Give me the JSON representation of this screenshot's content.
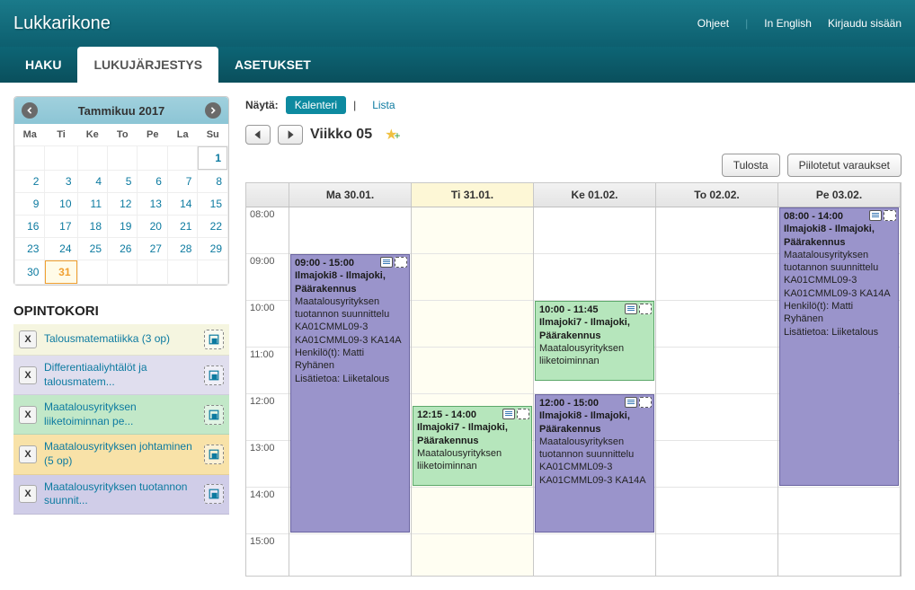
{
  "header": {
    "brand": "Lukkarikone",
    "links": {
      "help": "Ohjeet",
      "lang": "In English",
      "login": "Kirjaudu sisään"
    }
  },
  "nav": {
    "tabs": [
      "HAKU",
      "LUKUJÄRJESTYS",
      "ASETUKSET"
    ],
    "active": 1
  },
  "calendar": {
    "title": "Tammikuu 2017",
    "dow": [
      "Ma",
      "Ti",
      "Ke",
      "To",
      "Pe",
      "La",
      "Su"
    ],
    "weeks": [
      [
        "",
        "",
        "",
        "",
        "",
        "",
        "1"
      ],
      [
        "2",
        "3",
        "4",
        "5",
        "6",
        "7",
        "8"
      ],
      [
        "9",
        "10",
        "11",
        "12",
        "13",
        "14",
        "15"
      ],
      [
        "16",
        "17",
        "18",
        "19",
        "20",
        "21",
        "22"
      ],
      [
        "23",
        "24",
        "25",
        "26",
        "27",
        "28",
        "29"
      ],
      [
        "30",
        "31",
        "",
        "",
        "",
        "",
        ""
      ]
    ],
    "today": "31"
  },
  "basket": {
    "title": "OPINTOKORI",
    "items": [
      {
        "label": "Talousmatematiikka (3 op)",
        "color": "c0"
      },
      {
        "label": "Differentiaaliyhtälöt ja talousmatem...",
        "color": "c1"
      },
      {
        "label": "Maatalousyrityksen liiketoiminnan pe...",
        "color": "c2"
      },
      {
        "label": "Maatalousyrityksen johtaminen (5 op)",
        "color": "c3"
      },
      {
        "label": "Maatalousyrityksen tuotannon suunnit...",
        "color": "c4"
      }
    ]
  },
  "view": {
    "label": "Näytä:",
    "calendar": "Kalenteri",
    "list": "Lista"
  },
  "week": {
    "title": "Viikko 05"
  },
  "buttons": {
    "print": "Tulosta",
    "hidden": "Piilotetut varaukset"
  },
  "schedule": {
    "days": [
      "Ma 30.01.",
      "Ti 31.01.",
      "Ke 01.02.",
      "To 02.02.",
      "Pe 03.02."
    ],
    "todayIndex": 1,
    "hours": [
      "08:00",
      "09:00",
      "10:00",
      "11:00",
      "12:00",
      "13:00",
      "14:00",
      "15:00"
    ],
    "events": [
      {
        "day": 0,
        "start": "09:00",
        "end": "15:00",
        "color": "purple",
        "time": "09:00 - 15:00",
        "loc": "Ilmajoki8 - Ilmajoki, Päärakennus",
        "lines": [
          "Maatalousyrityksen tuotannon suunnittelu KA01CMML09-3",
          "",
          "KA01CMML09-3 KA14A",
          "Henkilö(t): Matti Ryhänen",
          "Lisätietoa: Liiketalous"
        ]
      },
      {
        "day": 1,
        "start": "12:15",
        "end": "14:00",
        "color": "green",
        "time": "12:15 - 14:00",
        "loc": "Ilmajoki7 - Ilmajoki, Päärakennus",
        "lines": [
          "Maatalousyrityksen liiketoiminnan"
        ]
      },
      {
        "day": 2,
        "start": "10:00",
        "end": "11:45",
        "color": "green",
        "time": "10:00 - 11:45",
        "loc": "Ilmajoki7 - Ilmajoki, Päärakennus",
        "lines": [
          "Maatalousyrityksen liiketoiminnan"
        ]
      },
      {
        "day": 2,
        "start": "12:00",
        "end": "15:00",
        "color": "purple",
        "time": "12:00 - 15:00",
        "loc": "Ilmajoki8 - Ilmajoki, Päärakennus",
        "lines": [
          "Maatalousyrityksen tuotannon suunnittelu KA01CMML09-3",
          "",
          "KA01CMML09-3 KA14A"
        ]
      },
      {
        "day": 4,
        "start": "08:00",
        "end": "14:00",
        "color": "purple",
        "time": "08:00 - 14:00",
        "loc": "Ilmajoki8 - Ilmajoki, Päärakennus",
        "lines": [
          "Maatalousyrityksen tuotannon suunnittelu KA01CMML09-3",
          "",
          "KA01CMML09-3 KA14A",
          "Henkilö(t): Matti Ryhänen",
          "Lisätietoa: Liiketalous"
        ]
      }
    ]
  }
}
